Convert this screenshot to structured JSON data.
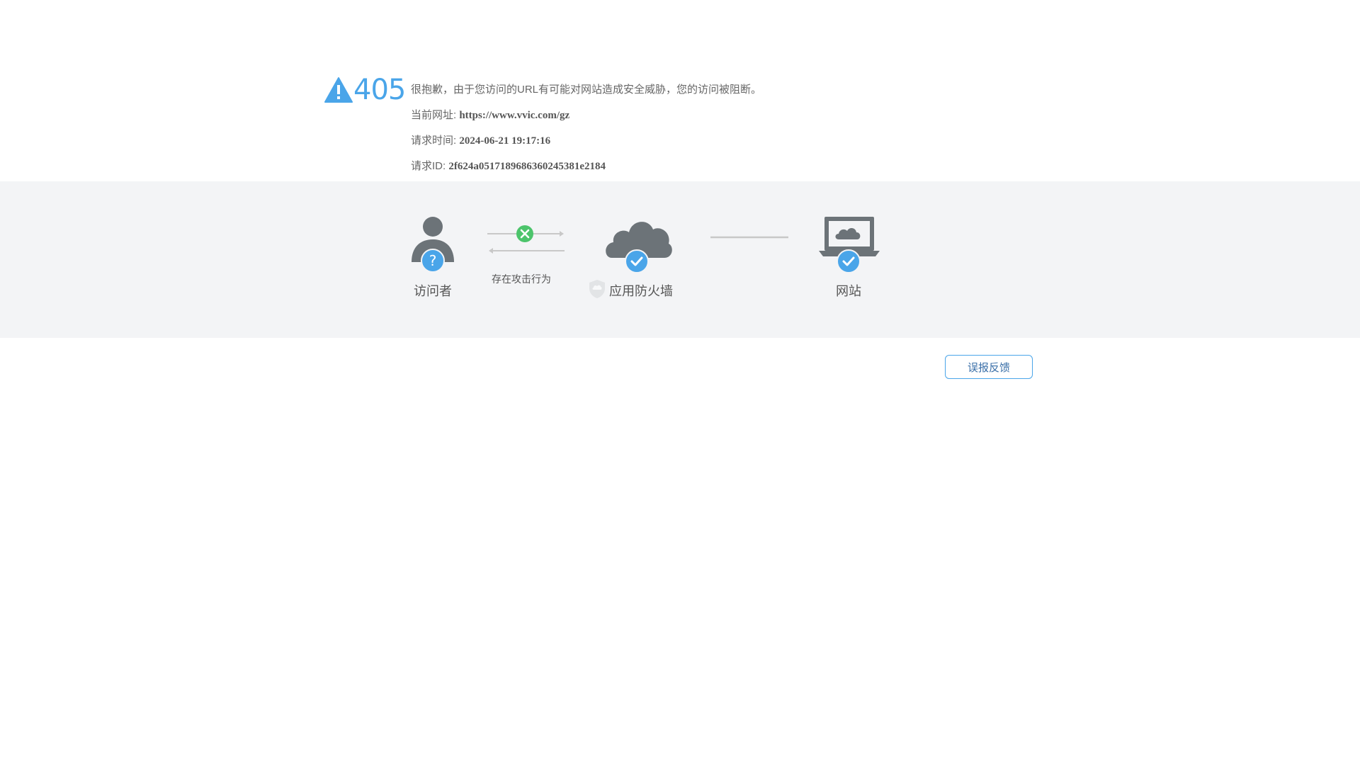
{
  "error": {
    "code": "405",
    "message": "很抱歉，由于您访问的URL有可能对网站造成安全威胁，您的访问被阻断。",
    "url_label": "当前网址:",
    "url_value": "https://www.vvic.com/gz",
    "time_label": "请求时间:",
    "time_value": "2024-06-21 19:17:16",
    "id_label": "请求ID:",
    "id_value": "2f624a0517189686360245381e2184"
  },
  "flow": {
    "visitor_label": "访问者",
    "attack_label": "存在攻击行为",
    "firewall_label": "应用防火墙",
    "website_label": "网站"
  },
  "actions": {
    "feedback_label": "误报反馈"
  },
  "colors": {
    "accent": "#4aa5e9",
    "icon_gray": "#6c7378",
    "blocked": "#4cc46b",
    "band_bg": "#f3f4f6"
  }
}
